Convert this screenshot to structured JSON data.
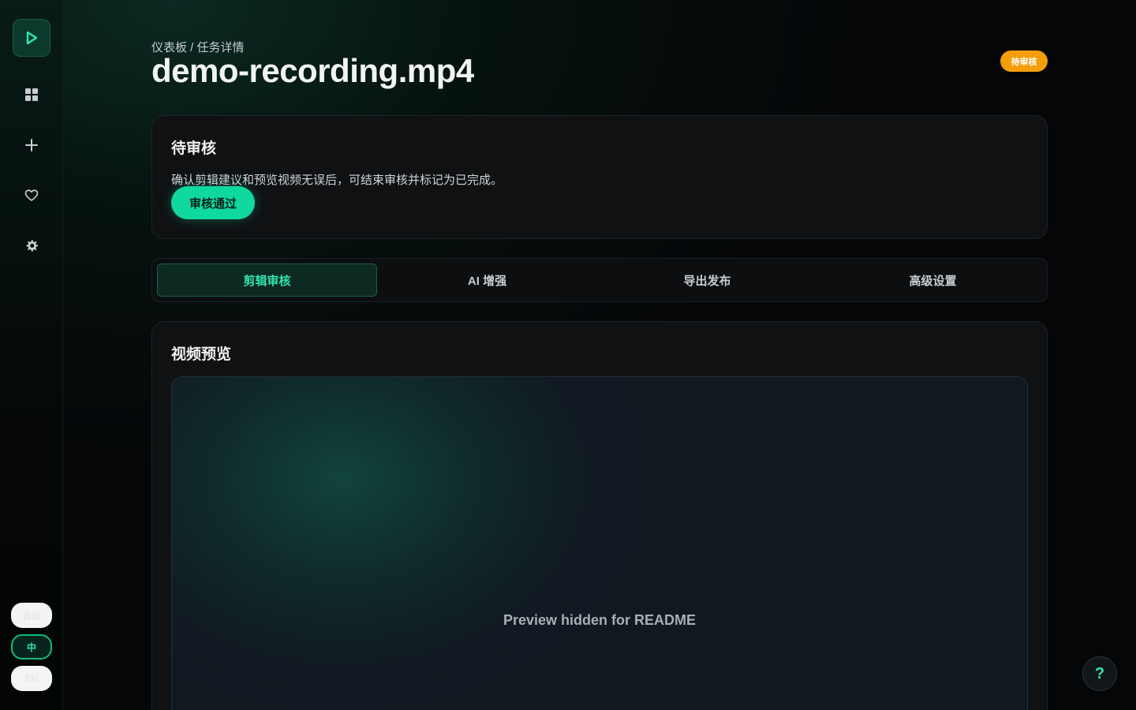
{
  "sidebar": {
    "logo_icon": "play-icon",
    "nav": [
      {
        "icon": "dashboard-grid-icon"
      },
      {
        "icon": "plus-icon"
      },
      {
        "icon": "heart-icon"
      },
      {
        "icon": "gear-icon"
      }
    ],
    "languages": {
      "auto": "自动",
      "zh": "中",
      "en": "EN"
    }
  },
  "header": {
    "breadcrumb": "仪表板 / 任务详情",
    "title": "demo-recording.mp4",
    "status_badge": "待审核"
  },
  "review": {
    "heading": "待审核",
    "description": "确认剪辑建议和预览视频无误后，可结束审核并标记为已完成。",
    "approve_label": "审核通过"
  },
  "tabs": [
    {
      "label": "剪辑审核",
      "active": true
    },
    {
      "label": "AI 增强",
      "active": false
    },
    {
      "label": "导出发布",
      "active": false
    },
    {
      "label": "高级设置",
      "active": false
    }
  ],
  "preview": {
    "heading": "视频预览",
    "placeholder": "Preview hidden for README"
  },
  "help": {
    "label": "?"
  },
  "colors": {
    "accent": "#10d9a0",
    "badge": "#f59e0b"
  }
}
